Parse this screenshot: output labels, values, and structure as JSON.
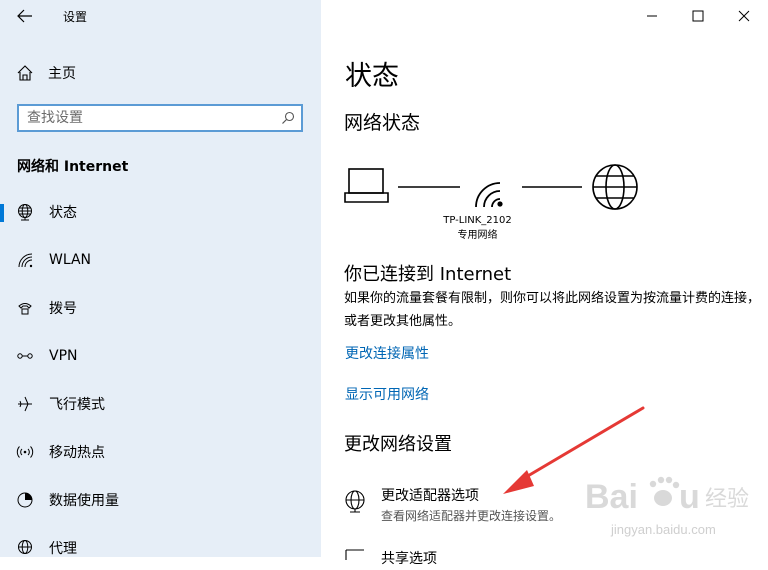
{
  "window": {
    "title": "设置",
    "back_icon": "back-arrow-icon",
    "controls": [
      "minimize-icon",
      "maximize-icon",
      "close-icon"
    ]
  },
  "sidebar": {
    "home_label": "主页",
    "search_placeholder": "查找设置",
    "section_title": "网络和 Internet",
    "items": [
      {
        "label": "状态",
        "icon": "globe-icon",
        "active": true
      },
      {
        "label": "WLAN",
        "icon": "wifi-icon",
        "active": false
      },
      {
        "label": "拨号",
        "icon": "dialup-icon",
        "active": false
      },
      {
        "label": "VPN",
        "icon": "vpn-icon",
        "active": false
      },
      {
        "label": "飞行模式",
        "icon": "airplane-icon",
        "active": false
      },
      {
        "label": "移动热点",
        "icon": "hotspot-icon",
        "active": false
      },
      {
        "label": "数据使用量",
        "icon": "data-usage-icon",
        "active": false
      },
      {
        "label": "代理",
        "icon": "globe-icon",
        "active": false
      }
    ]
  },
  "main": {
    "title": "状态",
    "network_status_heading": "网络状态",
    "network_name": "TP-LINK_2102",
    "network_type": "专用网络",
    "connected_title": "你已连接到 Internet",
    "connected_desc": "如果你的流量套餐有限制，则你可以将此网络设置为按流量计费的连接，或者更改其他属性。",
    "link_change_props": "更改连接属性",
    "link_show_networks": "显示可用网络",
    "change_heading": "更改网络设置",
    "options": [
      {
        "label": "更改适配器选项",
        "desc": "查看网络适配器并更改连接设置。",
        "icon": "adapter-icon"
      },
      {
        "label": "共享选项",
        "desc": "",
        "icon": "sharing-icon"
      }
    ]
  },
  "colors": {
    "accent": "#0078d7",
    "link": "#0066b4",
    "sidebar_bg": "#e6eef7",
    "annotation_arrow": "#e53935"
  },
  "watermark": {
    "brand": "Baidu",
    "brand_cn": "经验",
    "url": "jingyan.baidu.com"
  }
}
